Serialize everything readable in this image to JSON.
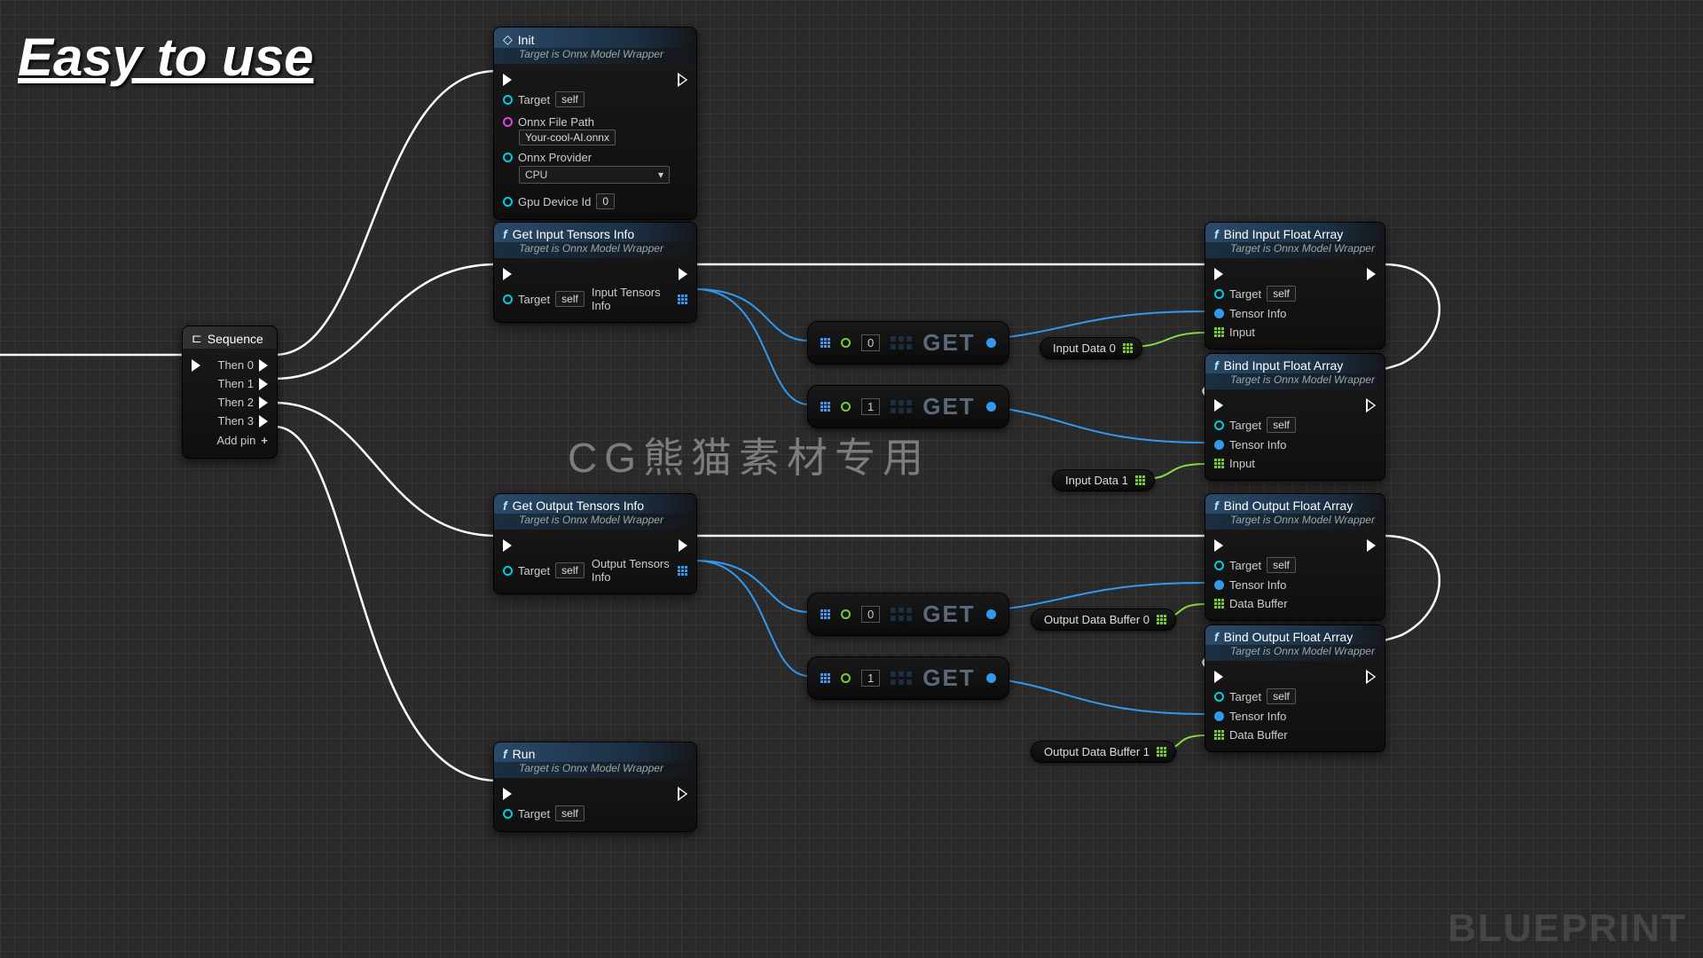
{
  "title": "Easy to use",
  "watermark": "CG熊猫素材专用",
  "brand": "BLUEPRINT",
  "sequence": {
    "title": "Sequence",
    "pins": [
      "Then 0",
      "Then 1",
      "Then 2",
      "Then 3"
    ],
    "addpin": "Add pin"
  },
  "init": {
    "title": "Init",
    "sub": "Target is Onnx Model Wrapper",
    "target": "Target",
    "self": "self",
    "filepath_lbl": "Onnx File Path",
    "filepath_val": "Your-cool-AI.onnx",
    "provider_lbl": "Onnx Provider",
    "provider_val": "CPU",
    "gpu_lbl": "Gpu Device Id",
    "gpu_val": "0"
  },
  "get_in": {
    "title": "Get Input Tensors Info",
    "sub": "Target is Onnx Model Wrapper",
    "target": "Target",
    "self": "self",
    "out": "Input Tensors Info"
  },
  "get_out": {
    "title": "Get Output Tensors Info",
    "sub": "Target is Onnx Model Wrapper",
    "target": "Target",
    "self": "self",
    "out": "Output Tensors Info"
  },
  "run": {
    "title": "Run",
    "sub": "Target is Onnx Model Wrapper",
    "target": "Target",
    "self": "self"
  },
  "get_lbl": "GET",
  "get_idx": [
    "0",
    "1",
    "0",
    "1"
  ],
  "bind_in": {
    "title": "Bind Input Float Array",
    "sub": "Target is Onnx Model Wrapper",
    "target": "Target",
    "self": "self",
    "tensor": "Tensor Info",
    "input": "Input"
  },
  "bind_out": {
    "title": "Bind Output Float Array",
    "sub": "Target is Onnx Model Wrapper",
    "target": "Target",
    "self": "self",
    "tensor": "Tensor Info",
    "output": "Data Buffer"
  },
  "pills": [
    "Input Data 0",
    "Input Data 1",
    "Output Data Buffer 0",
    "Output Data Buffer 1"
  ]
}
